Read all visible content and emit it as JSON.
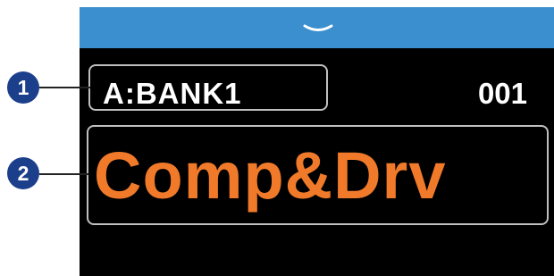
{
  "top_bar": {
    "icon": "chevron-down-icon",
    "color": "#3b8fce"
  },
  "display": {
    "bank_label": "A:BANK1",
    "patch_number": "001",
    "patch_name": "Comp&Drv",
    "patch_name_color": "#f07a2a"
  },
  "callouts": {
    "badge_1": "1",
    "badge_2": "2",
    "badge_color": "#1c3f8c"
  }
}
